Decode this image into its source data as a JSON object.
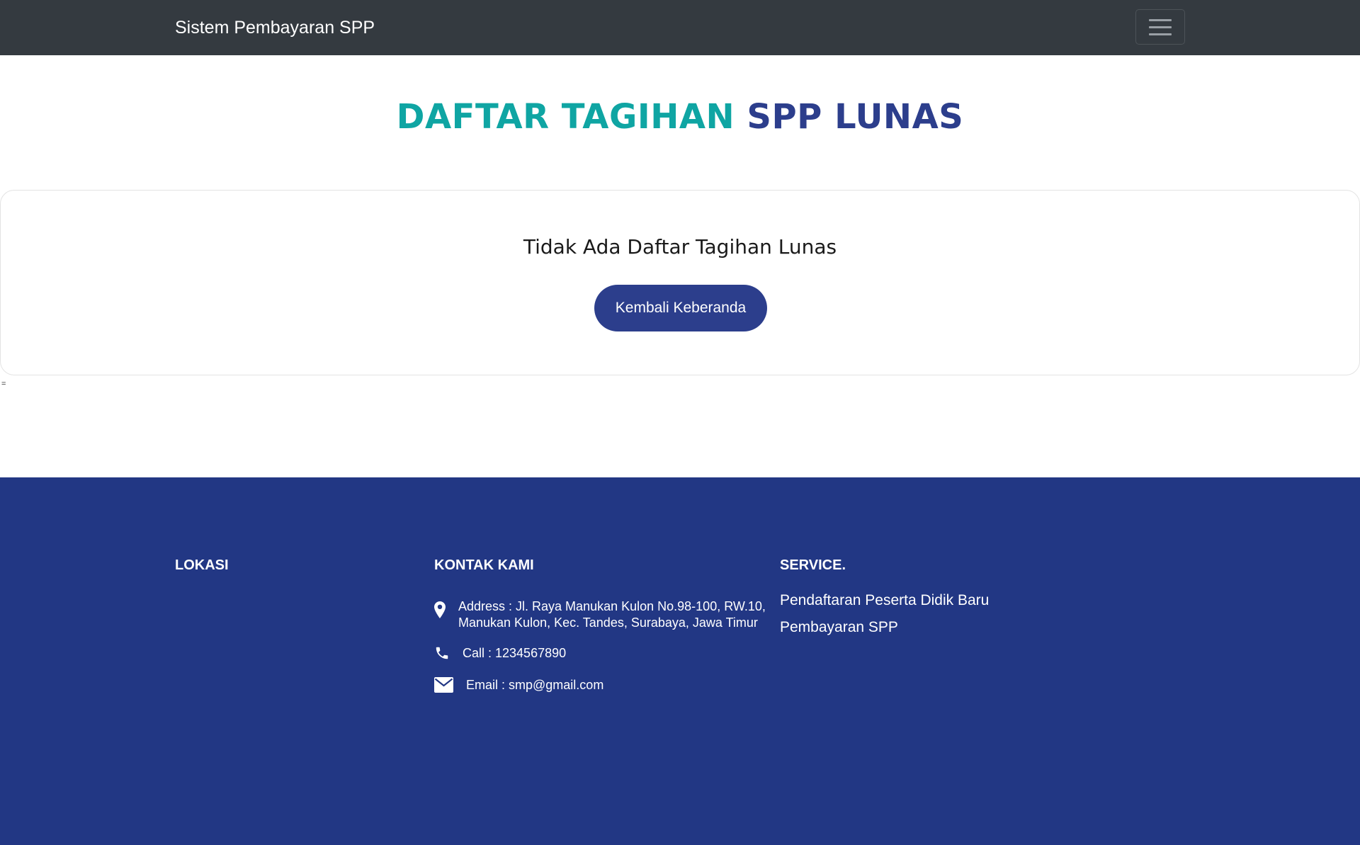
{
  "navbar": {
    "brand": "Sistem Pembayaran SPP",
    "toggler_icon": "hamburger-menu-icon"
  },
  "heading": {
    "part1": "DAFTAR TAGIHAN",
    "part2": "SPP LUNAS",
    "color1": "#0fa5a3",
    "color2": "#2c3e8c"
  },
  "card": {
    "message": "Tidak Ada Daftar Tagihan Lunas",
    "button_label": "Kembali Keberanda"
  },
  "stray_text": "=",
  "footer": {
    "background": "#223784",
    "location_title": "LOKASI",
    "contact_title": "KONTAK KAMI",
    "contact": {
      "address_line1": "Address : Jl. Raya Manukan Kulon No.98-100, RW.10,",
      "address_line2": "Manukan Kulon, Kec. Tandes, Surabaya, Jawa Timur",
      "call": "Call : 1234567890",
      "email": "Email : smp@gmail.com"
    },
    "service_title": "SERVICE.",
    "services": [
      "Pendaftaran Peserta Didik Baru",
      "Pembayaran SPP"
    ]
  }
}
